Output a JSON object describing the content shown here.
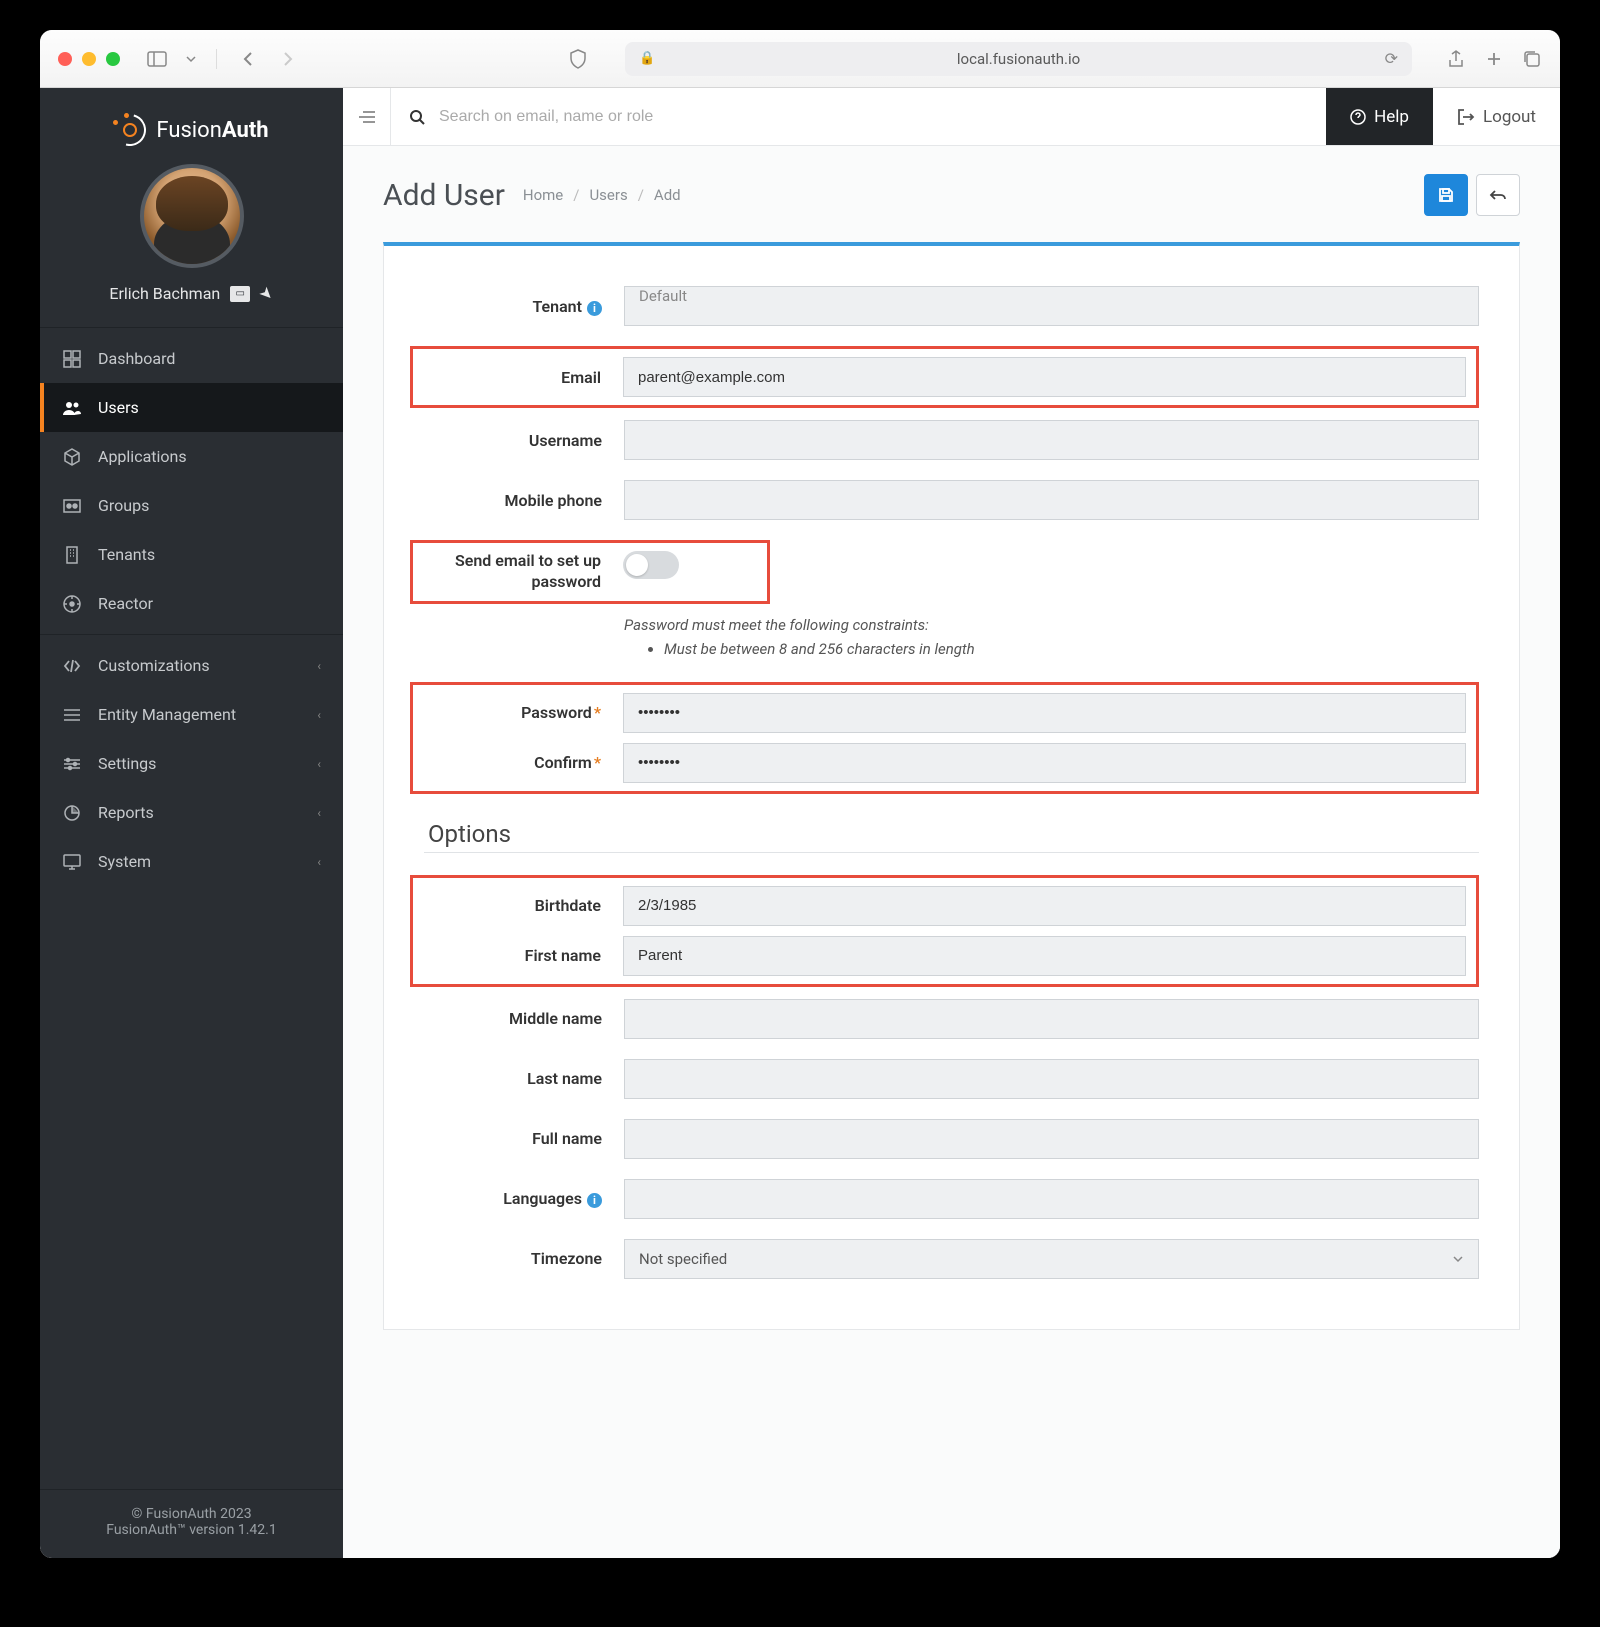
{
  "url": "local.fusionauth.io",
  "brand": {
    "name_a": "Fusion",
    "name_b": "Auth"
  },
  "user": {
    "name": "Erlich Bachman"
  },
  "nav": {
    "dashboard": "Dashboard",
    "users": "Users",
    "applications": "Applications",
    "groups": "Groups",
    "tenants": "Tenants",
    "reactor": "Reactor",
    "customizations": "Customizations",
    "entity": "Entity Management",
    "settings": "Settings",
    "reports": "Reports",
    "system": "System"
  },
  "footer": {
    "copyright": "© FusionAuth 2023",
    "version": "FusionAuth™ version 1.42.1"
  },
  "search": {
    "placeholder": "Search on email, name or role"
  },
  "topbar": {
    "help": "Help",
    "logout": "Logout"
  },
  "page": {
    "title": "Add User"
  },
  "breadcrumb": {
    "home": "Home",
    "users": "Users",
    "add": "Add"
  },
  "labels": {
    "tenant": "Tenant",
    "email": "Email",
    "username": "Username",
    "mobile": "Mobile phone",
    "sendEmail": "Send email to set up password",
    "password": "Password",
    "confirm": "Confirm",
    "options": "Options",
    "birthdate": "Birthdate",
    "firstname": "First name",
    "middlename": "Middle name",
    "lastname": "Last name",
    "fullname": "Full name",
    "languages": "Languages",
    "timezone": "Timezone"
  },
  "values": {
    "tenant": "Default",
    "email": "parent@example.com",
    "username": "",
    "mobile": "",
    "password": "••••••••",
    "confirm": "••••••••",
    "birthdate": "2/3/1985",
    "firstname": "Parent",
    "middlename": "",
    "lastname": "",
    "fullname": "",
    "languages": "",
    "timezone": "Not specified"
  },
  "hints": {
    "pwTitle": "Password must meet the following constraints:",
    "pwRule": "Must be between 8 and 256 characters in length"
  }
}
